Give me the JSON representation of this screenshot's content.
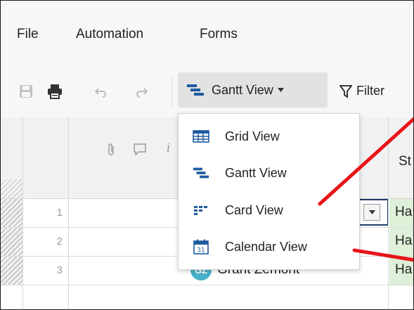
{
  "menu": {
    "file": "File",
    "automation": "Automation",
    "forms": "Forms"
  },
  "toolbar": {
    "view_button_label": "Gantt View",
    "filter_label": "Filter"
  },
  "dropdown": {
    "items": [
      {
        "label": "Grid View"
      },
      {
        "label": "Gantt View"
      },
      {
        "label": "Card View"
      },
      {
        "label": "Calendar View"
      }
    ]
  },
  "grid": {
    "partial_header": "St",
    "rows": [
      {
        "number": "1",
        "status": "Ha"
      },
      {
        "number": "2",
        "status": "Ha"
      },
      {
        "number": "3",
        "status": "Ha",
        "avatar": "GZ",
        "name": "Grant Zemont"
      }
    ]
  },
  "colors": {
    "status_green": "#dff0d8",
    "avatar": "#47b0c9",
    "annotation_arrow": "#e8141a",
    "gantt_icon_blue": "#1e5b9e"
  }
}
